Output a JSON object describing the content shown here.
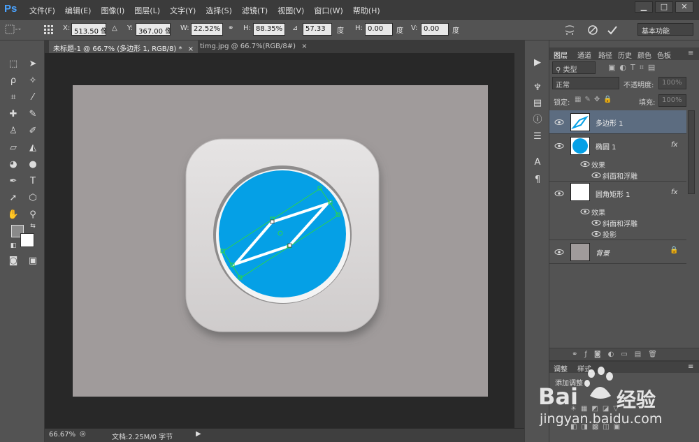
{
  "menubar": {
    "logo": "Ps",
    "items": [
      "文件(F)",
      "编辑(E)",
      "图像(I)",
      "图层(L)",
      "文字(Y)",
      "选择(S)",
      "滤镜(T)",
      "视图(V)",
      "窗口(W)",
      "帮助(H)"
    ],
    "window_buttons": [
      "▁",
      "□",
      "✕"
    ]
  },
  "options": {
    "x_label": "X:",
    "x_value": "513.50 像",
    "y_label": "Y:",
    "y_value": "367.00 像",
    "w_label": "W:",
    "w_value": "22.52%",
    "h_label": "H:",
    "h_value": "88.35%",
    "angle_value": "57.33",
    "angle_unit": "度",
    "hskew_label": "H:",
    "hskew_value": "0.00",
    "hskew_unit": "度",
    "vskew_label": "V:",
    "vskew_value": "0.00",
    "vskew_unit": "度",
    "workspace": "基本功能"
  },
  "document": {
    "tab_active": "未标题-1 @ 66.7% (多边形 1, RGB/8) *",
    "tab_close": "×",
    "tab_inactive": "timg.jpg @ 66.7%(RGB/8#)",
    "tab2_close": "×",
    "zoom": "66.67%",
    "doc_info": "文档:2.25M/0 字节"
  },
  "colors": {
    "canvas_bg": "#a09b9b",
    "icon_tile": "#d6d3d3",
    "circle_blue": "#05a0e6",
    "selected_layer": "#5c6c80"
  },
  "panel": {
    "tabs": [
      "图层",
      "通道",
      "路径",
      "历史",
      "颜色",
      "色板"
    ],
    "kind_filter": "类型",
    "blend_mode": "正常",
    "opacity_label": "不透明度:",
    "opacity_value": "100%",
    "lock_label": "锁定:",
    "fill_label": "填充:",
    "fill_value": "100%",
    "layers": [
      {
        "name": "多边形 1"
      },
      {
        "name": "椭圆 1",
        "fx": "fx",
        "effects_label": "效果",
        "effects": [
          "斜面和浮雕"
        ]
      },
      {
        "name": "圆角矩形 1",
        "fx": "fx",
        "effects_label": "效果",
        "effects": [
          "斜面和浮雕",
          "投影"
        ]
      },
      {
        "name": "背景"
      }
    ]
  },
  "adjustments": {
    "tabs": [
      "调整",
      "样式"
    ],
    "add_label": "添加调整"
  },
  "watermark": {
    "brand_left": "Bai",
    "brand_right": "经验",
    "url": "jingyan.baidu.com"
  }
}
